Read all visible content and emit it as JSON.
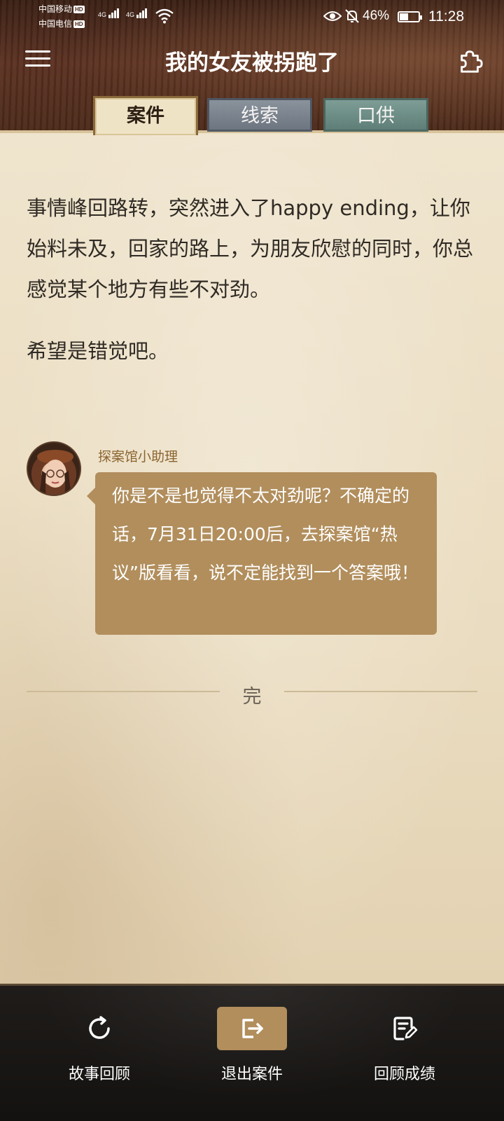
{
  "status_bar": {
    "carrier1": "中国移动",
    "carrier2": "中国电信",
    "hd_label": "HD",
    "net1": "4G",
    "net2": "4G",
    "battery": "46%",
    "battery_level": 0.46,
    "time": "11:28"
  },
  "header": {
    "title": "我的女友被拐跑了"
  },
  "tabs": [
    {
      "label": "案件",
      "active": true
    },
    {
      "label": "线索",
      "active": false
    },
    {
      "label": "口供",
      "active": false
    }
  ],
  "story": {
    "paragraphs": [
      "事情峰回路转，突然进入了happy ending，让你始料未及，回家的路上，为朋友欣慰的同时，你总感觉某个地方有些不对劲。",
      "希望是错觉吧。"
    ]
  },
  "assistant": {
    "name": "探案馆小助理",
    "message": "你是不是也觉得不太对劲呢？不确定的话，7月31日20:00后，去探案馆“热议”版看看，说不定能找到一个答案哦！"
  },
  "end_marker": "完",
  "bottom_bar": {
    "review_story": "故事回顾",
    "exit_case": "退出案件",
    "review_score": "回顾成绩"
  },
  "colors": {
    "accent": "#b18e5c",
    "paper": "#ebdfc5",
    "header_wood": "#4a2818"
  }
}
